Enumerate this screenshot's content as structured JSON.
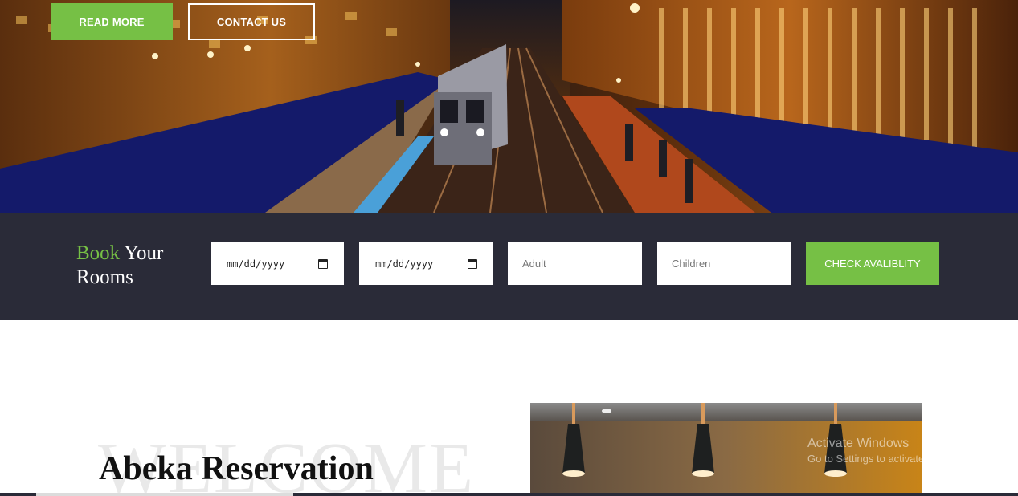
{
  "hero": {
    "read_more_label": "READ MORE",
    "contact_label": "CONTACT US"
  },
  "booking": {
    "title_accent": "Book",
    "title_rest": " Your",
    "title_line2": "Rooms",
    "checkin_value": "mm/dd/yyyy",
    "checkout_value": "mm/dd/yyyy",
    "adult_placeholder": "Adult",
    "children_placeholder": "Children",
    "check_button_label": "CHECK AVALIBLITY"
  },
  "welcome": {
    "background_word": "WELCOME",
    "title": "Abeka Reservation"
  },
  "watermark": {
    "line1": "Activate Windows",
    "line2": "Go to Settings to activate Windows."
  },
  "colors": {
    "accent": "#76c045",
    "booking_bar": "#2a2b38"
  },
  "icons": {
    "date_picker": "calendar-icon"
  }
}
